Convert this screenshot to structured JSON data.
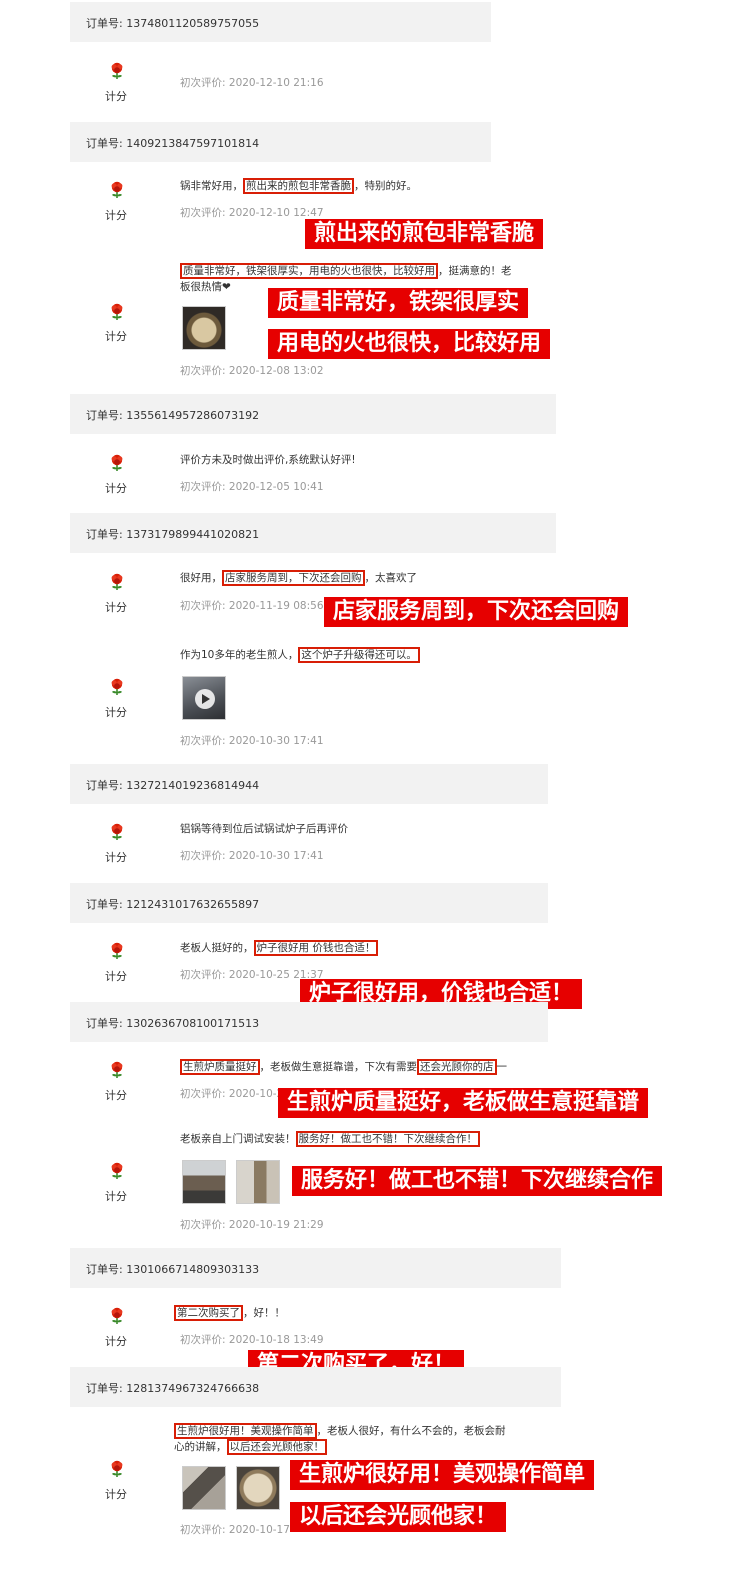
{
  "labels": {
    "order_prefix": "订单号: ",
    "score": "计分",
    "date_prefix": "初次评价: "
  },
  "orders": [
    {
      "id": "1374801120589757055"
    },
    {
      "id": "1409213847597101814"
    },
    {
      "id": "1355614957286073192"
    },
    {
      "id": "1373179899441020821"
    },
    {
      "id": "1327214019236814944"
    },
    {
      "id": "1212431017632655897"
    },
    {
      "id": "1302636708100171513"
    },
    {
      "id": "1301066714809303133"
    },
    {
      "id": "1281374967324766638"
    }
  ],
  "reviews": [
    {
      "date": "2020-12-10 21:16"
    },
    {
      "t1": "锅非常好用，",
      "h1": "煎出来的煎包非常香脆",
      "t2": "，特别的好。",
      "date": "2020-12-10 12:47"
    },
    {
      "h1": "质量非常好，铁架很厚实，用电的火也很快，比较好用",
      "t2": "，挺满意的！老",
      "t3": "板很热情❤",
      "date": "2020-12-08 13:02"
    },
    {
      "t1": "评价方未及时做出评价,系统默认好评!",
      "date": "2020-12-05 10:41"
    },
    {
      "t1": "很好用，",
      "h1": "店家服务周到，下次还会回购",
      "t2": "，太喜欢了",
      "date": "2020-11-19 08:56"
    },
    {
      "t1": "作为10多年的老生煎人，",
      "h1": "这个炉子升级得还可以。",
      "date": "2020-10-30 17:41"
    },
    {
      "t1": "铝锅等待到位后试锅试炉子后再评价",
      "date": "2020-10-30 17:41"
    },
    {
      "t1": "老板人挺好的，",
      "h1": "炉子很好用 价钱也合适！",
      "date": "2020-10-25 21:37"
    },
    {
      "h1": "生煎炉质量挺好",
      "t1": "，老板做生意挺靠谱",
      "t2": "，下次有需要",
      "h2": "还会光顾你的店",
      "t3": "一",
      "date": "2020-10-2"
    },
    {
      "t1": "老板亲自上门调试安装！",
      "h1": "服务好！做工也不错！下次继续合作！",
      "date": "2020-10-19 21:29"
    },
    {
      "h1": "第二次购买了",
      "t1": "，好！！",
      "date": "2020-10-18 13:49"
    },
    {
      "h1": "生煎炉很好用！美观操作简单",
      "t1": "，老板人很好，有什么不会的，老板会耐",
      "t2": "心的讲解，",
      "h2": "以后还会光顾他家！",
      "date": "2020-10-17"
    }
  ],
  "overlays": [
    "煎出来的煎包非常香脆",
    "质量非常好，铁架很厚实",
    "用电的火也很快，比较好用",
    "店家服务周到，下次还会回购",
    "炉子很好用，价钱也合适！",
    "生煎炉质量挺好，老板做生意挺靠谱",
    "服务好！做工也不错！下次继续合作",
    "第二次购买了，好！",
    "生煎炉很好用！美观操作简单",
    "以后还会光顾他家！"
  ],
  "icons": {
    "rating": "rose-icon",
    "video": "play-icon"
  },
  "colors": {
    "highlight": "#e60000",
    "bar": "#f2f2f2",
    "date": "#999999"
  }
}
